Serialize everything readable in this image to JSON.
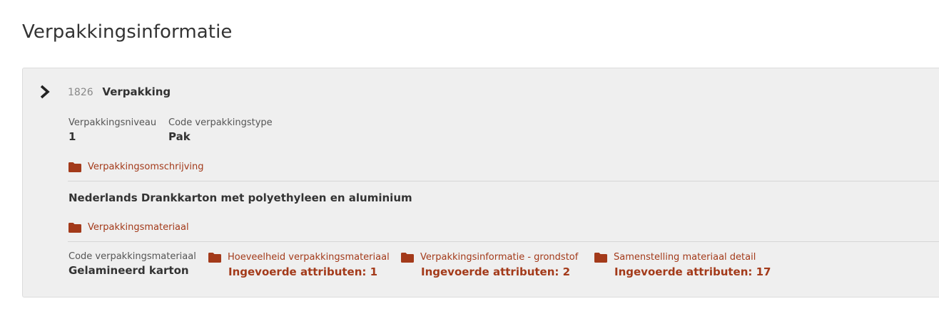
{
  "page": {
    "title": "Verpakkingsinformatie"
  },
  "colors": {
    "accent": "#a33a1a",
    "card_background": "#efefef"
  },
  "card": {
    "expand_icon": "chevron-right-icon",
    "id": "1826",
    "name": "Verpakking",
    "fields": {
      "niveau_label": "Verpakkingsniveau",
      "niveau_value": "1",
      "type_label": "Code verpakkingstype",
      "type_value": "Pak"
    },
    "omschrijving": {
      "icon": "folder-icon",
      "label": "Verpakkingsomschrijving",
      "text": "Nederlands Drankkarton met polyethyleen en aluminium"
    },
    "materiaal": {
      "icon": "folder-icon",
      "label": "Verpakkingsmateriaal",
      "code_label": "Code verpakkingsmateriaal",
      "code_value": "Gelamineerd karton",
      "groups": [
        {
          "label": "Hoeveelheid verpakkingsmateriaal",
          "count": "Ingevoerde attributen: 1"
        },
        {
          "label": "Verpakkingsinformatie - grondstof",
          "count": "Ingevoerde attributen: 2"
        },
        {
          "label": "Samenstelling materiaal detail",
          "count": "Ingevoerde attributen: 17"
        }
      ]
    }
  }
}
